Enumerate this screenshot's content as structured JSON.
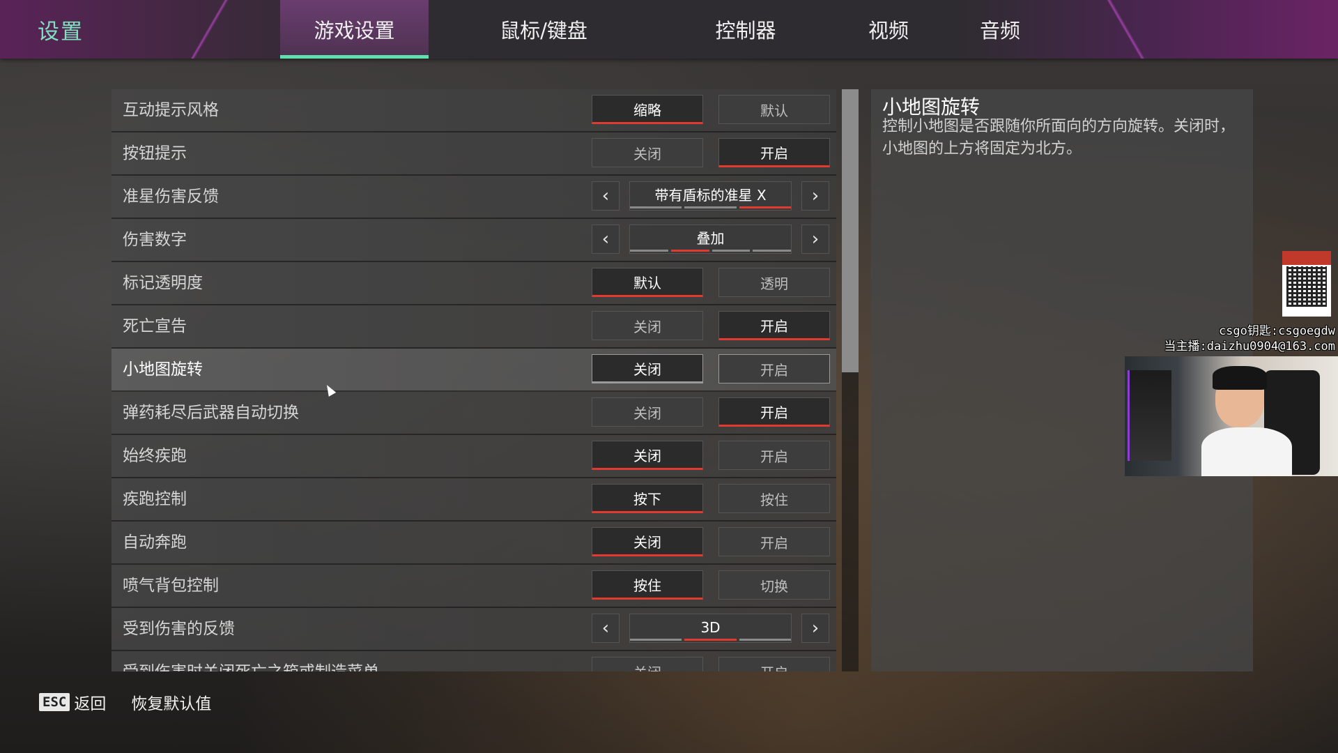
{
  "header": {
    "title": "设置",
    "tabs": [
      {
        "label": "游戏设置",
        "active": true
      },
      {
        "label": "鼠标/键盘",
        "active": false
      },
      {
        "label": "控制器",
        "active": false
      },
      {
        "label": "视频",
        "active": false
      },
      {
        "label": "音频",
        "active": false
      }
    ]
  },
  "settings": [
    {
      "label": "互动提示风格",
      "type": "toggle",
      "options": [
        "缩略",
        "默认"
      ],
      "selected": 0
    },
    {
      "label": "按钮提示",
      "type": "toggle",
      "options": [
        "关闭",
        "开启"
      ],
      "selected": 1
    },
    {
      "label": "准星伤害反馈",
      "type": "cycle",
      "value": "带有盾标的准星 X",
      "segments": 3,
      "selected_segment": 2
    },
    {
      "label": "伤害数字",
      "type": "cycle",
      "value": "叠加",
      "segments": 4,
      "selected_segment": 1
    },
    {
      "label": "标记透明度",
      "type": "toggle",
      "options": [
        "默认",
        "透明"
      ],
      "selected": 0
    },
    {
      "label": "死亡宣告",
      "type": "toggle",
      "options": [
        "关闭",
        "开启"
      ],
      "selected": 1
    },
    {
      "label": "小地图旋转",
      "type": "toggle",
      "options": [
        "关闭",
        "开启"
      ],
      "selected": 0,
      "highlighted": true
    },
    {
      "label": "弹药耗尽后武器自动切换",
      "type": "toggle",
      "options": [
        "关闭",
        "开启"
      ],
      "selected": 1
    },
    {
      "label": "始终疾跑",
      "type": "toggle",
      "options": [
        "关闭",
        "开启"
      ],
      "selected": 0
    },
    {
      "label": "疾跑控制",
      "type": "toggle",
      "options": [
        "按下",
        "按住"
      ],
      "selected": 0
    },
    {
      "label": "自动奔跑",
      "type": "toggle",
      "options": [
        "关闭",
        "开启"
      ],
      "selected": 0
    },
    {
      "label": "喷气背包控制",
      "type": "toggle",
      "options": [
        "按住",
        "切换"
      ],
      "selected": 0
    },
    {
      "label": "受到伤害的反馈",
      "type": "cycle",
      "value": "3D",
      "segments": 3,
      "selected_segment": 1
    },
    {
      "label": "受到伤害时关闭死亡之箱或制造菜单",
      "type": "toggle",
      "options": [
        "关闭",
        "开启"
      ],
      "selected": 0
    }
  ],
  "description": {
    "title": "小地图旋转",
    "text": "控制小地图是否跟随你所面向的方向旋转。关闭时，小地图的上方将固定为北方。"
  },
  "footer": {
    "esc_key": "ESC",
    "back_label": "返回",
    "reset_label": "恢复默认值"
  },
  "overlay": {
    "line1": "csgo钥匙:csgoegdw",
    "line2": "当主播:daizhu0904@163.com"
  },
  "colors": {
    "accent_green": "#5ee0b0",
    "selected_underline": "#e23a2e",
    "header_purple": "#5a2358"
  }
}
